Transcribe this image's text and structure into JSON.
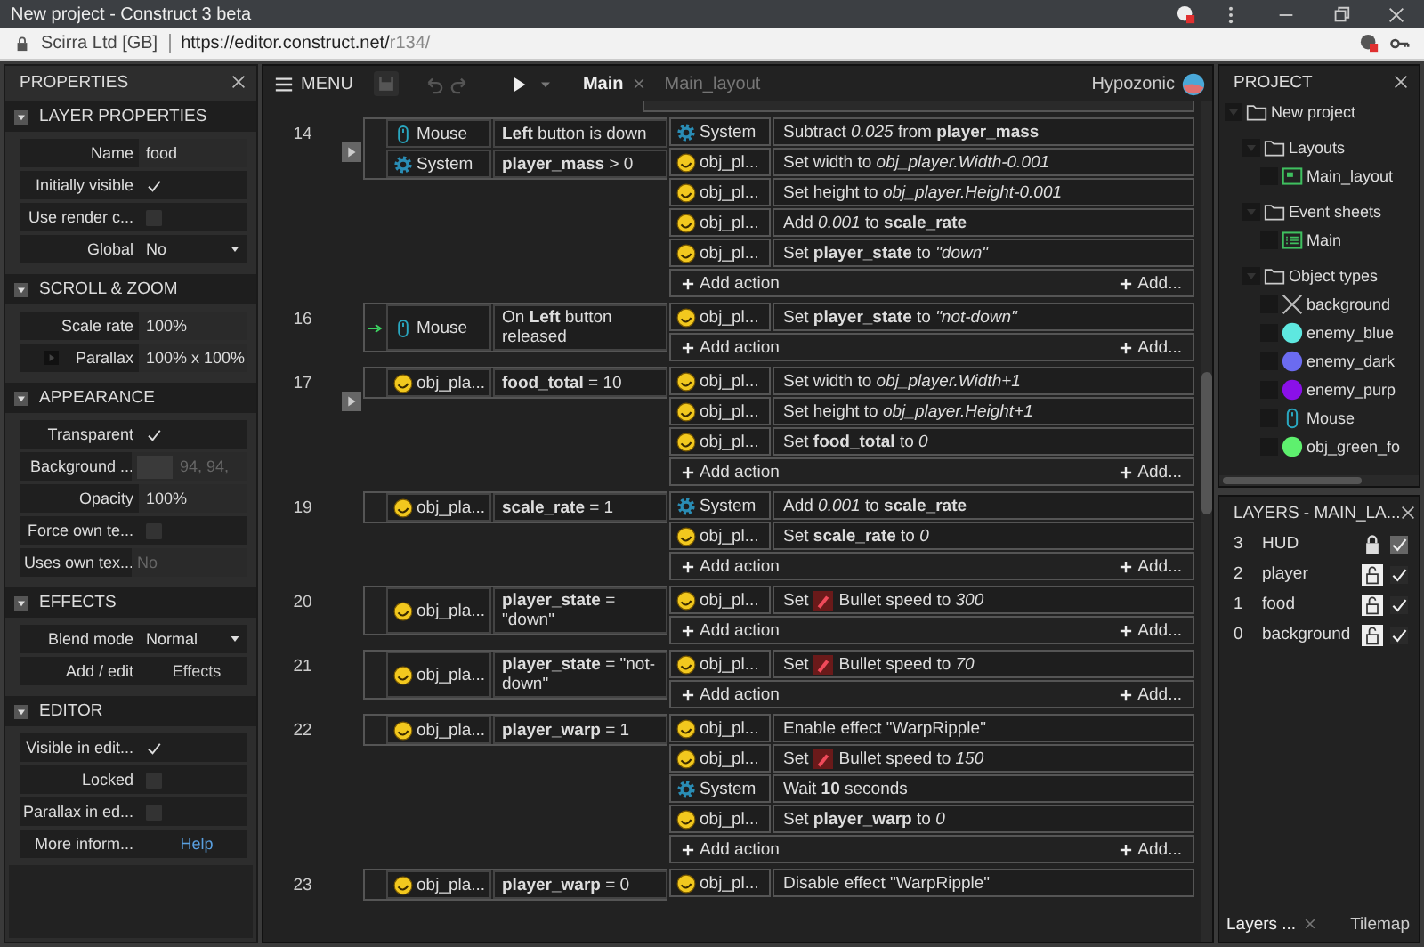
{
  "browser": {
    "title": "New project - Construct 3 beta",
    "site": "Scirra Ltd [GB]",
    "url_host": "https://editor.construct.net/",
    "url_path": "r134/"
  },
  "properties": {
    "title": "PROPERTIES",
    "sections": [
      {
        "title": "LAYER PROPERTIES",
        "expanded": true,
        "rows": [
          {
            "label": "Name",
            "kind": "text",
            "value": "food"
          },
          {
            "label": "Initially visible",
            "kind": "check",
            "checked": true
          },
          {
            "label": "Use render c...",
            "kind": "check",
            "checked": false
          },
          {
            "label": "Global",
            "kind": "select",
            "value": "No"
          }
        ]
      },
      {
        "title": "SCROLL & ZOOM",
        "expanded": true,
        "rows": [
          {
            "label": "Scale rate",
            "kind": "text",
            "value": "100%"
          },
          {
            "label": "Parallax",
            "kind": "group",
            "value": "100% x 100%"
          }
        ]
      },
      {
        "title": "APPEARANCE",
        "expanded": true,
        "rows": [
          {
            "label": "Transparent",
            "kind": "check",
            "checked": true
          },
          {
            "label": "Background ...",
            "kind": "color",
            "value": "94, 94,"
          },
          {
            "label": "Opacity",
            "kind": "text",
            "value": "100%"
          },
          {
            "label": "Force own te...",
            "kind": "check",
            "checked": false
          },
          {
            "label": "Uses own tex...",
            "kind": "disabled",
            "value": "No"
          }
        ]
      },
      {
        "title": "EFFECTS",
        "expanded": true,
        "rows": [
          {
            "label": "Blend mode",
            "kind": "select",
            "value": "Normal"
          },
          {
            "label": "Add / edit",
            "kind": "button",
            "value": "Effects"
          }
        ]
      },
      {
        "title": "EDITOR",
        "expanded": true,
        "rows": [
          {
            "label": "Visible in edit...",
            "kind": "check",
            "checked": true
          },
          {
            "label": "Locked",
            "kind": "check",
            "checked": false
          },
          {
            "label": "Parallax in ed...",
            "kind": "check",
            "checked": false
          },
          {
            "label": "More inform...",
            "kind": "link",
            "value": "Help"
          }
        ]
      }
    ]
  },
  "toolbar": {
    "menu": "MENU",
    "tabs": [
      {
        "label": "Main",
        "selected": true
      },
      {
        "label": "Main_layout",
        "selected": false
      }
    ],
    "user": "Hypozonic"
  },
  "events": [
    {
      "number": "14",
      "expander": true,
      "trigger": false,
      "conditions": [
        {
          "kind": "mouse",
          "object": "Mouse",
          "text": "**Left** button is down"
        },
        {
          "kind": "system",
          "object": "System",
          "text": "**player_mass** > 0"
        }
      ],
      "actions": [
        {
          "kind": "system",
          "object": "System",
          "text": "Subtract *0.025* from **player_mass**"
        },
        {
          "kind": "sprite",
          "object": "obj_pl...",
          "text": "Set width to *obj_player.Width-0.001*"
        },
        {
          "kind": "sprite",
          "object": "obj_pl...",
          "text": "Set height to *obj_player.Height-0.001*"
        },
        {
          "kind": "sprite",
          "object": "obj_pl...",
          "text": "Add *0.001* to **scale_rate**"
        },
        {
          "kind": "sprite",
          "object": "obj_pl...",
          "text": "Set **player_state** to *\"down\"*"
        }
      ],
      "add_action": "Add action",
      "add_more": "Add..."
    },
    {
      "number": "16",
      "expander": false,
      "trigger": true,
      "conditions": [
        {
          "kind": "mouse",
          "object": "Mouse",
          "text": "On **Left** button released"
        }
      ],
      "actions": [
        {
          "kind": "sprite",
          "object": "obj_pl...",
          "text": "Set **player_state** to *\"not-down\"*"
        }
      ],
      "add_action": "Add action",
      "add_more": "Add..."
    },
    {
      "number": "17",
      "expander": true,
      "trigger": false,
      "conditions": [
        {
          "kind": "sprite",
          "object": "obj_pla...",
          "text": "**food_total** = 10"
        }
      ],
      "actions": [
        {
          "kind": "sprite",
          "object": "obj_pl...",
          "text": "Set width to *obj_player.Width+1*"
        },
        {
          "kind": "sprite",
          "object": "obj_pl...",
          "text": "Set height to *obj_player.Height+1*"
        },
        {
          "kind": "sprite",
          "object": "obj_pl...",
          "text": "Set **food_total** to *0*"
        }
      ],
      "add_action": "Add action",
      "add_more": "Add..."
    },
    {
      "number": "19",
      "expander": false,
      "trigger": false,
      "conditions": [
        {
          "kind": "sprite",
          "object": "obj_pla...",
          "text": "**scale_rate** = 1"
        }
      ],
      "actions": [
        {
          "kind": "system",
          "object": "System",
          "text": "Add *0.001* to **scale_rate**"
        },
        {
          "kind": "sprite",
          "object": "obj_pl...",
          "text": "Set **scale_rate** to *0*"
        }
      ],
      "add_action": "Add action",
      "add_more": "Add..."
    },
    {
      "number": "20",
      "expander": false,
      "trigger": false,
      "conditions": [
        {
          "kind": "sprite",
          "object": "obj_pla...",
          "text": "**player_state** = \"down\""
        }
      ],
      "actions": [
        {
          "kind": "sprite",
          "object": "obj_pl...",
          "text": "Set",
          "behavior": "Bullet speed to *300*"
        }
      ],
      "add_action": "Add action",
      "add_more": "Add..."
    },
    {
      "number": "21",
      "expander": false,
      "trigger": false,
      "conditions": [
        {
          "kind": "sprite",
          "object": "obj_pla...",
          "text": "**player_state** = \"not-down\""
        }
      ],
      "actions": [
        {
          "kind": "sprite",
          "object": "obj_pl...",
          "text": "Set",
          "behavior": "Bullet speed to *70*"
        }
      ],
      "add_action": "Add action",
      "add_more": "Add..."
    },
    {
      "number": "22",
      "expander": false,
      "trigger": false,
      "conditions": [
        {
          "kind": "sprite",
          "object": "obj_pla...",
          "text": "**player_warp** = 1"
        }
      ],
      "actions": [
        {
          "kind": "sprite",
          "object": "obj_pl...",
          "text": "Enable effect \"WarpRipple\""
        },
        {
          "kind": "sprite",
          "object": "obj_pl...",
          "text": "Set",
          "behavior": "Bullet speed to *150*"
        },
        {
          "kind": "system",
          "object": "System",
          "text": "Wait **10** seconds"
        },
        {
          "kind": "sprite",
          "object": "obj_pl...",
          "text": "Set **player_warp** to *0*"
        }
      ],
      "add_action": "Add action",
      "add_more": "Add..."
    },
    {
      "number": "23",
      "expander": false,
      "trigger": false,
      "conditions": [
        {
          "kind": "sprite",
          "object": "obj_pla...",
          "text": "**player_warp** = 0"
        }
      ],
      "actions": [
        {
          "kind": "sprite",
          "object": "obj_pl...",
          "text": "Disable effect \"WarpRipple\""
        }
      ]
    }
  ],
  "project": {
    "title": "PROJECT",
    "tree": [
      {
        "label": "New project",
        "kind": "folder",
        "expanded": true,
        "children": [
          {
            "label": "Layouts",
            "kind": "folder",
            "expanded": true,
            "children": [
              {
                "label": "Main_layout",
                "kind": "layout",
                "checked": false
              }
            ]
          },
          {
            "label": "Event sheets",
            "kind": "folder",
            "expanded": true,
            "children": [
              {
                "label": "Main",
                "kind": "sheet",
                "checked": false
              }
            ]
          },
          {
            "label": "Object types",
            "kind": "folder",
            "expanded": true,
            "children": [
              {
                "label": "background",
                "kind": "tiled",
                "checked": false
              },
              {
                "label": "enemy_blue",
                "kind": "sprite",
                "color": "#5ee8e0",
                "checked": false
              },
              {
                "label": "enemy_dark",
                "kind": "sprite",
                "color": "#6b6bf0",
                "checked": false
              },
              {
                "label": "enemy_purp",
                "kind": "sprite",
                "color": "#8a10e8",
                "checked": false
              },
              {
                "label": "Mouse",
                "kind": "mouse",
                "checked": false
              },
              {
                "label": "obj_green_fo",
                "kind": "sprite",
                "color": "#5ef06e",
                "checked": false
              }
            ]
          }
        ]
      }
    ]
  },
  "layers": {
    "title": "LAYERS - MAIN_LA...",
    "rows": [
      {
        "number": "3",
        "name": "HUD",
        "locked": true,
        "visible": true
      },
      {
        "number": "2",
        "name": "player",
        "locked": false,
        "visible": true
      },
      {
        "number": "1",
        "name": "food",
        "locked": false,
        "visible": true
      },
      {
        "number": "0",
        "name": "background",
        "locked": false,
        "visible": true
      }
    ]
  },
  "bottom_tabs": [
    {
      "label": "Layers ...",
      "selected": true
    },
    {
      "label": "Tilemap",
      "selected": false
    }
  ]
}
